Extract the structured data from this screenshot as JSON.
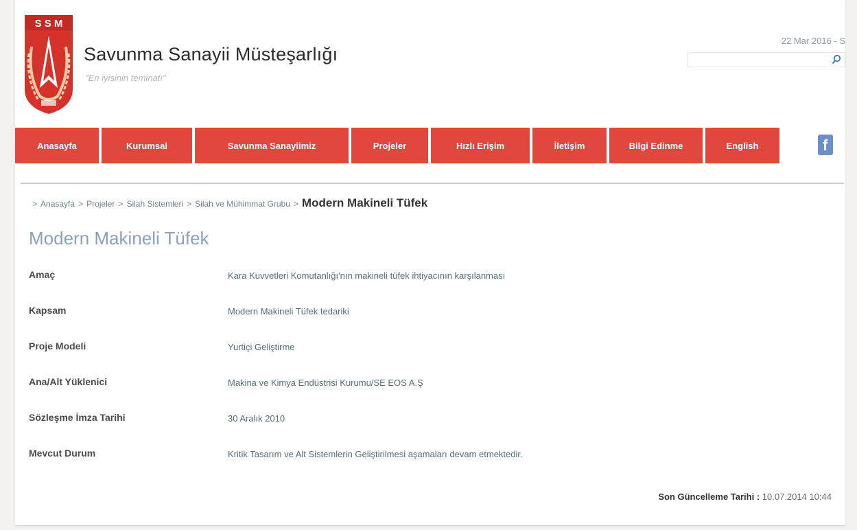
{
  "header": {
    "logo_text": "SSM",
    "site_title": "Savunma Sanayii Müsteşarlığı",
    "tagline": "\"En iyisinin teminatı\"",
    "date": "22 Mar 2016 - S",
    "search": {
      "value": "",
      "placeholder": ""
    }
  },
  "nav": {
    "items": [
      {
        "label": "Anasayfa"
      },
      {
        "label": "Kurumsal"
      },
      {
        "label": "Savunma Sanayiimiz"
      },
      {
        "label": "Projeler"
      },
      {
        "label": "Hızlı Erişim"
      },
      {
        "label": "İletişim"
      },
      {
        "label": "Bilgi Edinme"
      },
      {
        "label": "English"
      }
    ],
    "social": "f"
  },
  "breadcrumb": {
    "items": [
      "Anasayfa",
      "Projeler",
      "Silah Sistemleri",
      "Silah ve Mühimmat Grubu"
    ],
    "current": "Modern Makineli Tüfek",
    "separator": ">"
  },
  "page_title": "Modern Makineli Tüfek",
  "details": [
    {
      "label": "Amaç",
      "value": "Kara Kuvvetleri Komutanlığı'nın makineli tüfek ihtiyacının karşılanması"
    },
    {
      "label": "Kapsam",
      "value": "Modern Makineli Tüfek tedariki"
    },
    {
      "label": "Proje Modeli",
      "value": "Yurtiçi Geliştirme"
    },
    {
      "label": "Ana/Alt Yüklenici",
      "value": "Makina ve Kimya Endüstrisi Kurumu/SE EOS A.Ş"
    },
    {
      "label": "Sözleşme İmza Tarihi",
      "value": "30 Aralık 2010"
    },
    {
      "label": "Mevcut Durum",
      "value": "Kritik Tasarım ve Alt Sistemlerin Geliştirilmesi aşamaları devam etmektedir."
    }
  ],
  "footer": {
    "updated_label": "Son Güncelleme Tarihi :",
    "updated_value": "10.07.2014 10:44"
  },
  "colors": {
    "nav_red": "#e2473f",
    "title_blue": "#8ba2b6",
    "facebook": "#6d8ec8"
  }
}
